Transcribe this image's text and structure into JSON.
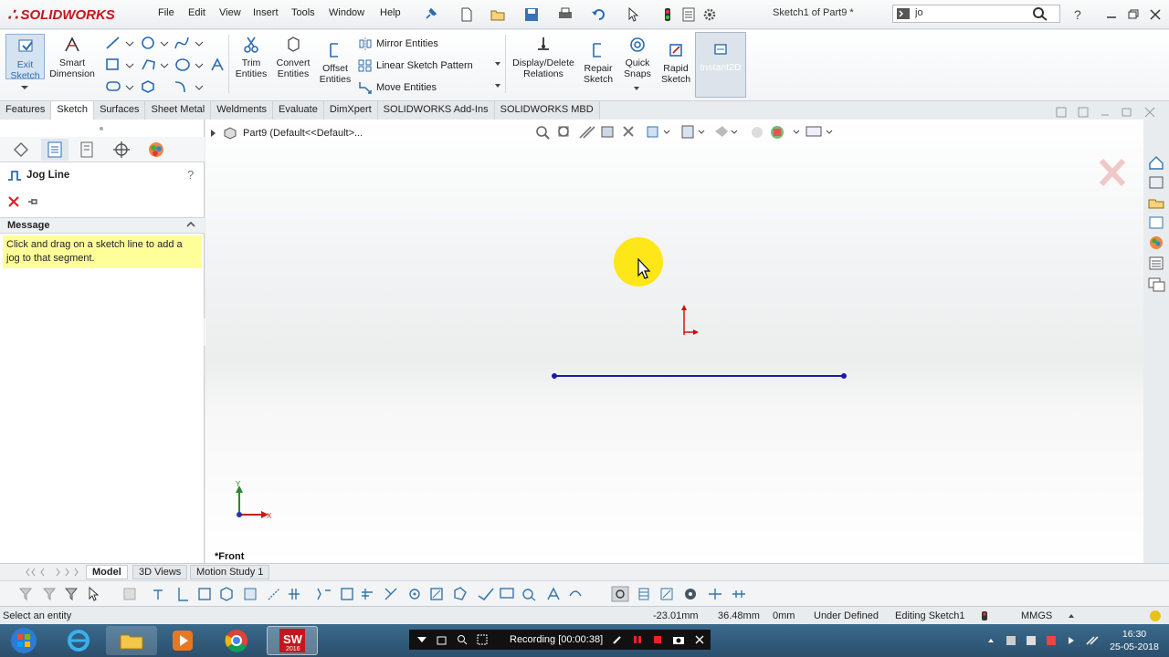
{
  "app": {
    "logo_text": "SOLIDWORKS",
    "document_title": "Sketch1 of Part9 *"
  },
  "menu": [
    "File",
    "Edit",
    "View",
    "Insert",
    "Tools",
    "Window",
    "Help"
  ],
  "search": {
    "value": "jo"
  },
  "ribbon": {
    "exit_sketch": "Exit\nSketch",
    "smart_dimension": "Smart\nDimension",
    "trim_entities": "Trim\nEntities",
    "convert_entities": "Convert\nEntities",
    "offset_entities": "Offset\nEntities",
    "mirror_entities": "Mirror Entities",
    "linear_sketch_pattern": "Linear Sketch Pattern",
    "move_entities": "Move Entities",
    "display_delete_relations": "Display/Delete\nRelations",
    "repair_sketch": "Repair\nSketch",
    "quick_snaps": "Quick\nSnaps",
    "rapid_sketch": "Rapid\nSketch",
    "instant2d": "Instant2D"
  },
  "tabs": [
    "Features",
    "Sketch",
    "Surfaces",
    "Sheet Metal",
    "Weldments",
    "Evaluate",
    "DimXpert",
    "SOLIDWORKS Add-Ins",
    "SOLIDWORKS MBD"
  ],
  "active_tab": "Sketch",
  "property_manager": {
    "title": "Jog Line",
    "message_header": "Message",
    "message_text": "Click and drag on a sketch line to add a jog to that segment."
  },
  "graphics": {
    "tree_crumb": "Part9  (Default<<Default>...",
    "view_label": "*Front",
    "axis_x": "X",
    "axis_y": "Y"
  },
  "bottom_tabs": [
    "Model",
    "3D Views",
    "Motion Study 1"
  ],
  "status": {
    "left": "Select an entity",
    "x": "-23.01mm",
    "y": "36.48mm",
    "z": "0mm",
    "state": "Under Defined",
    "editing": "Editing Sketch1",
    "units": "MMGS"
  },
  "taskbar": {
    "recording": "Recording [00:00:38]",
    "time": "16:30",
    "date": "25-05-2018",
    "sw_badge": "2016"
  },
  "colors": {
    "accent_red": "#c4161c",
    "sketch_line": "#1a1aa8",
    "message_bg": "#ffff99"
  }
}
